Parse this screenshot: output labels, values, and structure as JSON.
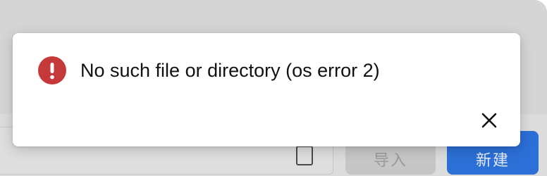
{
  "dialog": {
    "icon": "error-icon",
    "message": "No such file or directory (os error 2)",
    "close_icon": "close-icon",
    "accent_color": "#c5393a"
  },
  "background": {
    "import_button_label": "导入",
    "new_button_label": "新建",
    "primary_color": "#2c6fd6"
  }
}
